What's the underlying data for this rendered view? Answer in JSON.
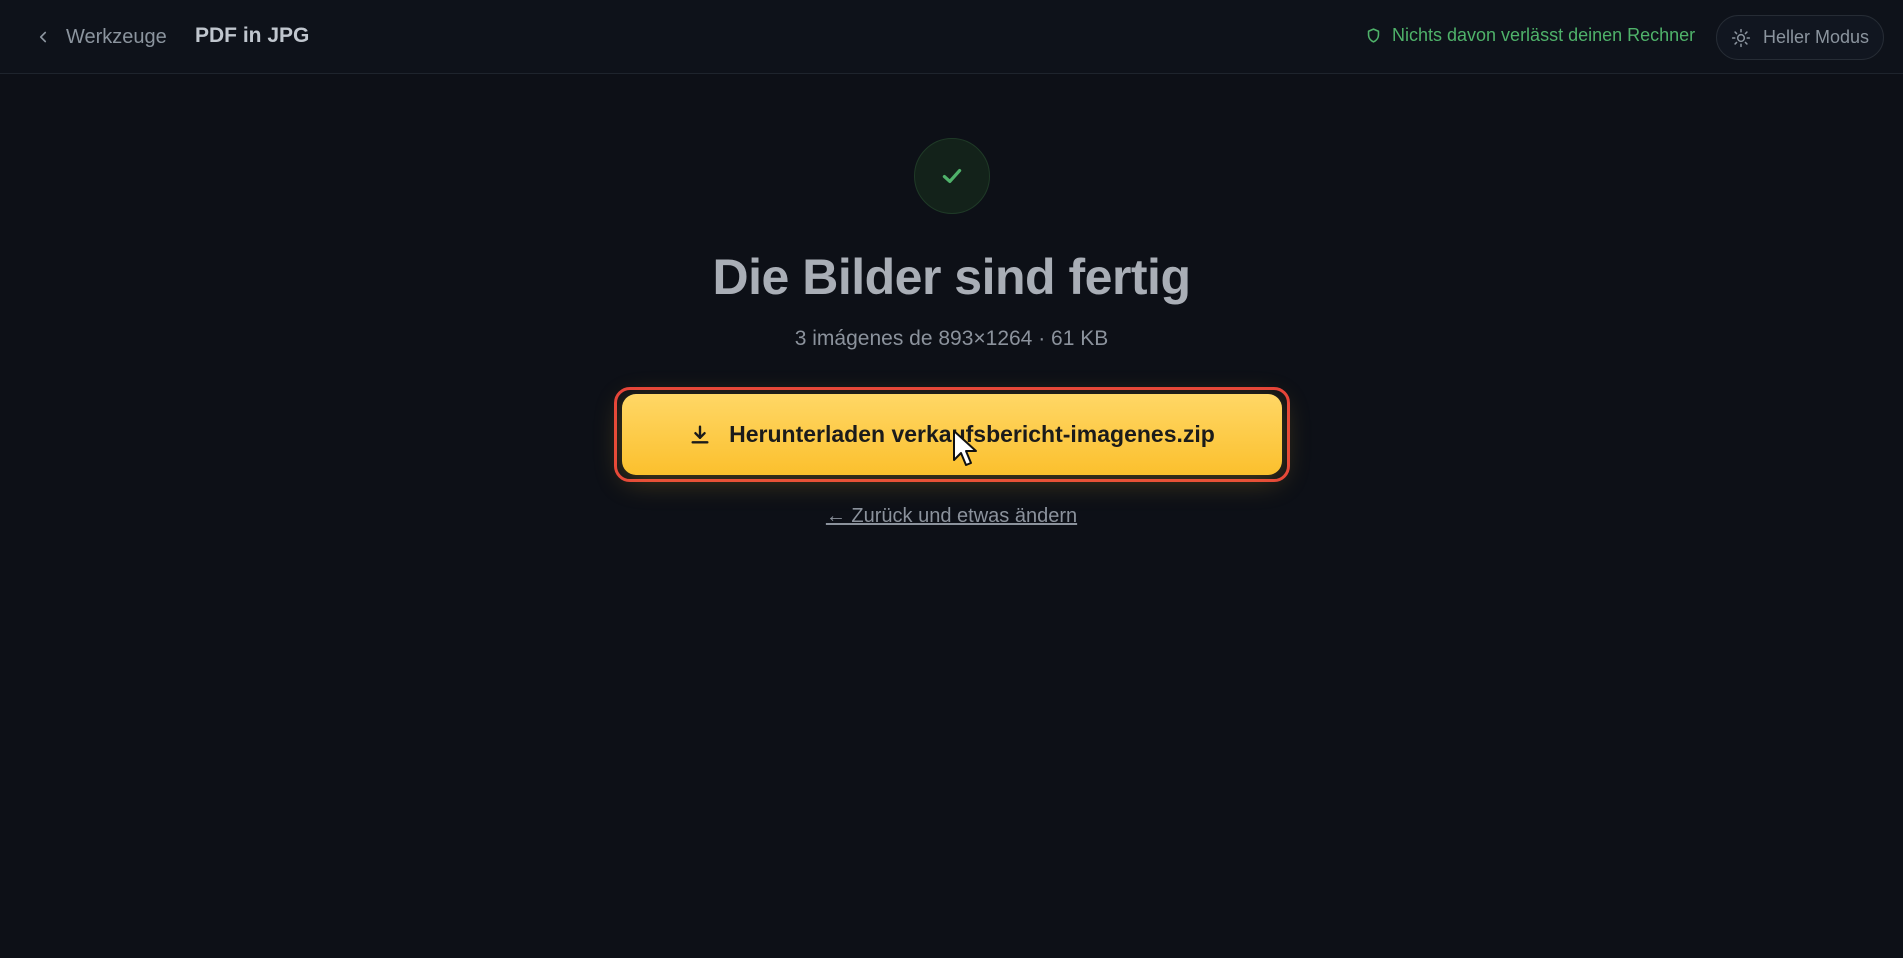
{
  "header": {
    "back_label": "Werkzeuge",
    "page_title": "PDF in JPG",
    "privacy_note": "Nichts davon verlässt deinen Rechner",
    "theme_toggle_label": "Heller Modus"
  },
  "result": {
    "status_icon": "check-icon",
    "headline": "Die Bilder sind fertig",
    "meta": "3 imágenes de 893×1264 · 61 KB",
    "download_label": "Herunterladen verkaufsbericht-imagenes.zip",
    "back_change_label": "← Zurück und etwas ändern"
  },
  "colors": {
    "background": "#0d1017",
    "accent_button": "#fbc02d",
    "focus_ring": "#e5423a",
    "success": "#4fb26a"
  }
}
